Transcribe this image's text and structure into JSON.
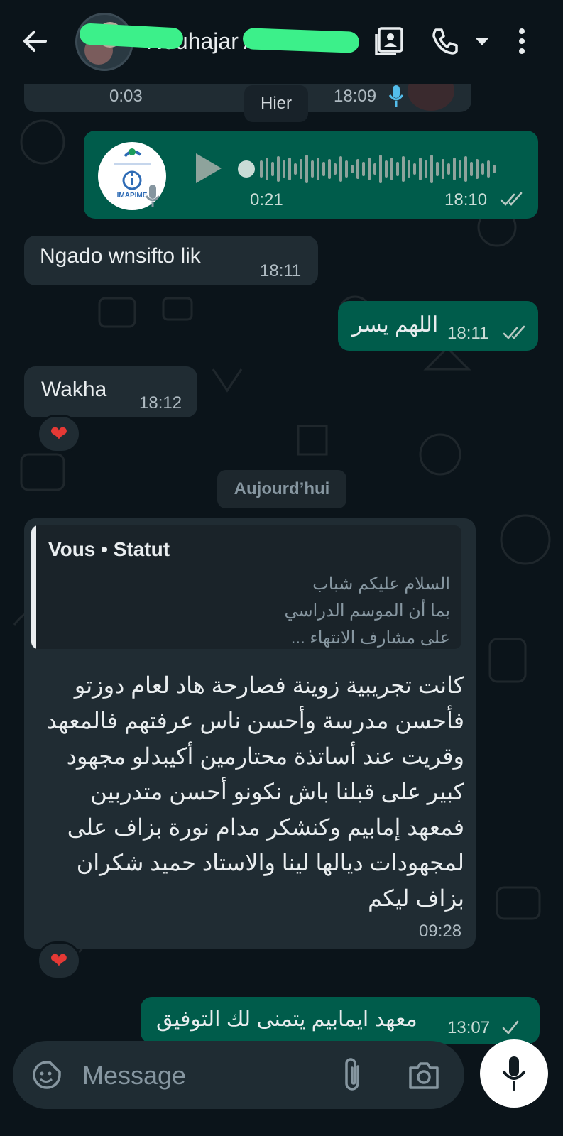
{
  "header": {
    "contact_name": "Nouhajar Ahssin",
    "icons": [
      "back-arrow-icon",
      "contact-card-icon",
      "phone-icon",
      "dropdown-caret-icon",
      "more-vertical-icon"
    ]
  },
  "messages": {
    "prev_voice": {
      "duration": "0:03",
      "time": "18:09"
    },
    "date_yesterday": "Hier",
    "voice_out": {
      "duration": "0:21",
      "time": "18:10",
      "logo_text": "IMAPIME"
    },
    "msg1": {
      "text": "Ngado wnsifto lik",
      "time": "18:11"
    },
    "msg2": {
      "text": "اللهم يسر",
      "time": "18:11"
    },
    "msg3": {
      "text": "Wakha",
      "time": "18:12",
      "reaction": "❤"
    },
    "date_today": "Aujourd’hui",
    "status_reply": {
      "quote_title": "Vous • Statut",
      "quote_lines": [
        "السلام عليكم شباب",
        "بما أن الموسم الدراسي",
        "على مشارف الانتهاء ..."
      ],
      "body_lines": [
        "كانت تجريبية زوينة فصارحة هاد لعام  دوزتو",
        "فأحسن مدرسة وأحسن ناس عرفتهم فالمعهد",
        "وقريت عند أساتذة محتارمين أكيبدلو مجهود",
        "كبير على قبلنا باش نكونو أحسن متدربين",
        "فمعهد إمابيم وكنشكر مدام نورة بزاف على",
        "لمجهودات ديالها لينا والاستاد حميد شكران",
        "بزاف ليكم"
      ],
      "time": "09:28",
      "reaction": "❤"
    },
    "msg4": {
      "text": "معهد ايمابيم يتمنى لك التوفيق",
      "time": "13:07"
    }
  },
  "composer": {
    "placeholder": "Message",
    "icons": [
      "sticker-icon",
      "attach-icon",
      "camera-icon",
      "mic-icon"
    ]
  },
  "colors": {
    "background": "#0b141a",
    "incoming_bubble": "#202c33",
    "outgoing_bubble": "#005c4b",
    "accent_green": "#00a884",
    "read_tick": "#8ab4ff"
  }
}
